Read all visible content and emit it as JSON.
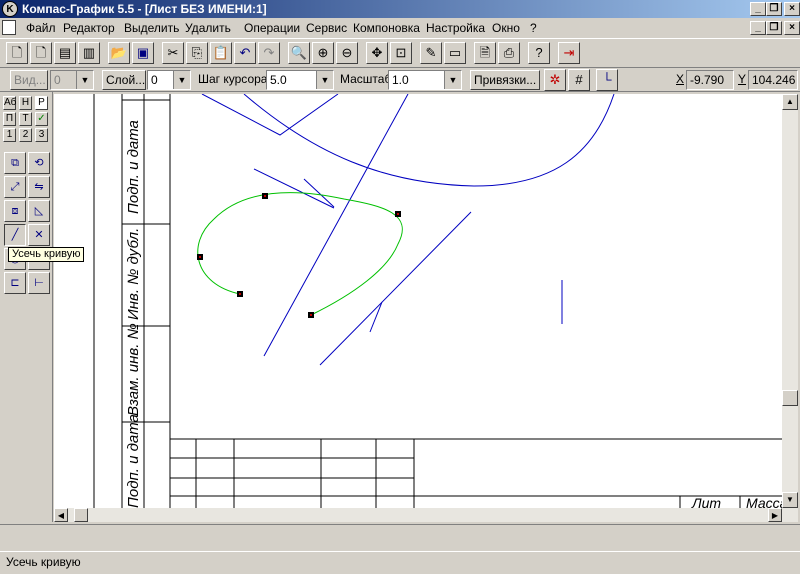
{
  "window": {
    "title": "Компас-График 5.5 - [Лист БЕЗ ИМЕНИ:1]",
    "app_icon": "kompas-logo-icon",
    "caption_buttons": [
      "_",
      "▫",
      "×"
    ]
  },
  "menu": {
    "items": [
      "Файл",
      "Редактор",
      "Выделить",
      "Удалить",
      "Операции",
      "Сервис",
      "Компоновка",
      "Настройка",
      "Окно",
      "?"
    ]
  },
  "toolbar": {
    "icons": [
      "new-sheet-icon",
      "new-fragment-icon",
      "new-text-doc-icon",
      "new-spec-icon",
      "open-icon",
      "save-icon",
      "cut-icon",
      "copy-icon",
      "paste-icon",
      "undo-icon",
      "redo-icon",
      "zoom-icon",
      "zoom-in-icon",
      "zoom-out-icon",
      "pan-icon",
      "zoom-all-icon",
      "redraw-icon",
      "show-all-icon",
      "preview-icon",
      "print-icon",
      "help-icon",
      "exit-icon"
    ]
  },
  "propbar": {
    "view_button": "Вид...",
    "view_value": "0",
    "layer_button": "Слой...",
    "layer_value": "0",
    "cursor_step_label": "Шаг курсора",
    "cursor_step_value": "5.0",
    "scale_label": "Масштаб",
    "scale_value": "1.0",
    "snaps_button": "Привязки...",
    "x_label": "X",
    "x_value": "-9.790",
    "y_label": "Y",
    "y_value": "104.246"
  },
  "leftpanel": {
    "tabs_top": [
      "Аб",
      "Н",
      "Р"
    ],
    "tabs_mid": [
      "П",
      "Т",
      "✓"
    ],
    "tabs_num": [
      "1",
      "2",
      "3"
    ]
  },
  "stamp": {
    "side_labels": [
      "Подп. и дата",
      "Инв. № дубл.",
      "Взам. инв. №",
      "Подп. и дата"
    ],
    "cell_lit": "Лит",
    "cell_mass": "Масса"
  },
  "tooltip": {
    "text": "Усечь кривую"
  },
  "status": {
    "text": "Усечь кривую"
  },
  "colors": {
    "title_start": "#0a246a",
    "title_end": "#a6caf0",
    "geometry": "#0000c0",
    "selection": "#00c000"
  }
}
